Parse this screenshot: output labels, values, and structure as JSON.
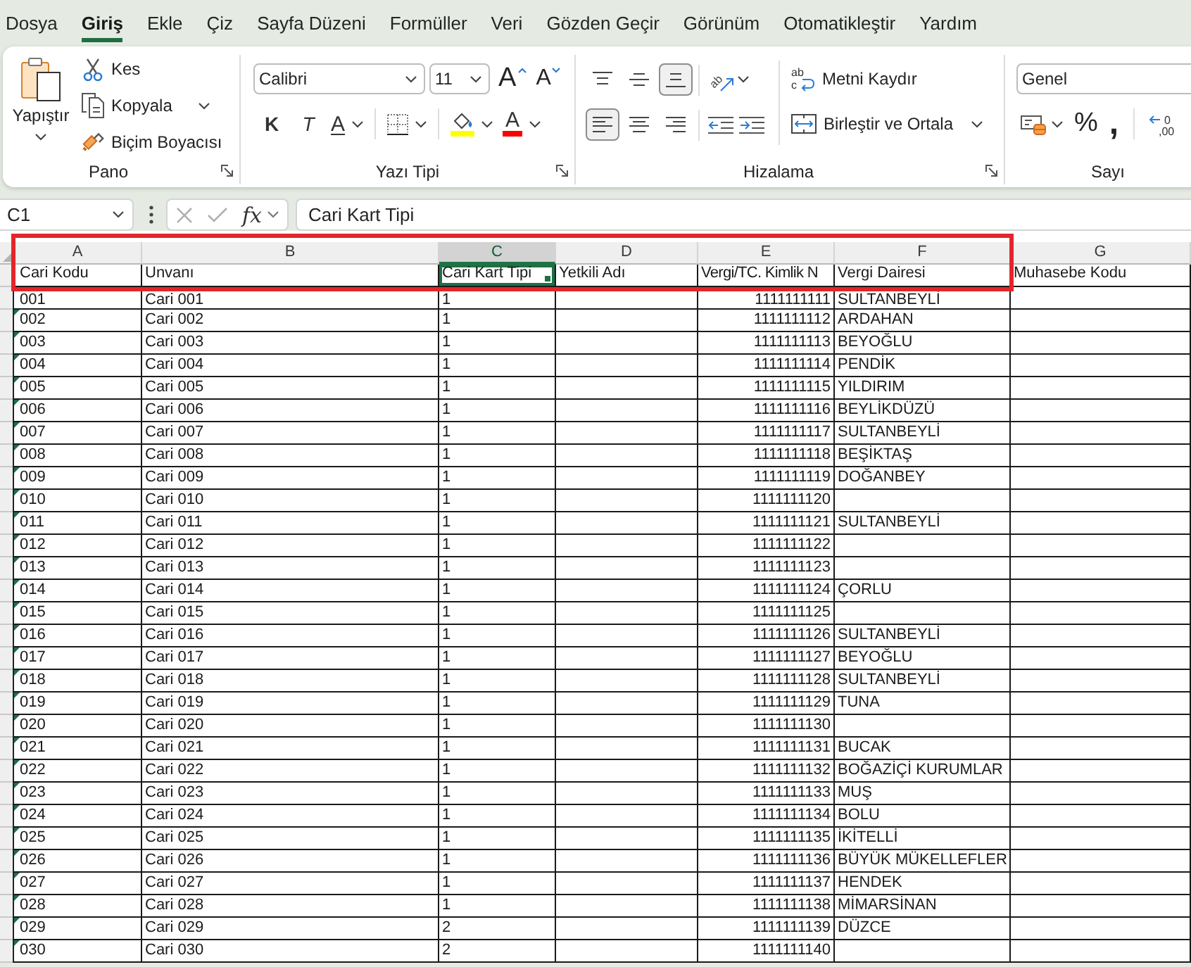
{
  "ribbon_tabs": [
    {
      "label": "Dosya",
      "selected": false
    },
    {
      "label": "Giriş",
      "selected": true
    },
    {
      "label": "Ekle",
      "selected": false
    },
    {
      "label": "Çiz",
      "selected": false
    },
    {
      "label": "Sayfa Düzeni",
      "selected": false
    },
    {
      "label": "Formüller",
      "selected": false
    },
    {
      "label": "Veri",
      "selected": false
    },
    {
      "label": "Gözden Geçir",
      "selected": false
    },
    {
      "label": "Görünüm",
      "selected": false
    },
    {
      "label": "Otomatikleştir",
      "selected": false
    },
    {
      "label": "Yardım",
      "selected": false
    }
  ],
  "clipboard_group": {
    "label": "Pano",
    "paste": "Yapıştır",
    "cut": "Kes",
    "copy": "Kopyala",
    "format_painter": "Biçim Boyacısı"
  },
  "font_group": {
    "label": "Yazı Tipi",
    "font_name": "Calibri",
    "font_size": "11",
    "grow_font": "A",
    "shrink_font": "A",
    "bold": "K",
    "italic": "T",
    "underline": "A",
    "font_color": "A"
  },
  "alignment_group": {
    "label": "Hizalama",
    "vertical": [
      {
        "kind": "top",
        "selected": false
      },
      {
        "kind": "middle",
        "selected": false
      },
      {
        "kind": "bottom",
        "selected": true
      }
    ],
    "horizontal": [
      {
        "kind": "left",
        "selected": true
      },
      {
        "kind": "center",
        "selected": false
      },
      {
        "kind": "right",
        "selected": false
      }
    ],
    "orientation_glyph": "ab",
    "wrap_glyph": "ab",
    "wrap_glyph_2": "c",
    "wrap_text": "Metni Kaydır",
    "merge_center": "Birleştir ve Ortala"
  },
  "number_group": {
    "label": "Sayı",
    "format": "Genel",
    "percent": "%",
    "comma": ",",
    "decimal_glyph": "0",
    "decimal_glyph_2": ",00"
  },
  "formula_bar": {
    "name_box": "C1",
    "fx": "fx",
    "formula": "Cari Kart Tipi"
  },
  "sheet": {
    "columns": [
      {
        "letter": "A",
        "selected": false
      },
      {
        "letter": "B",
        "selected": false
      },
      {
        "letter": "C",
        "selected": true
      },
      {
        "letter": "D",
        "selected": false
      },
      {
        "letter": "E",
        "selected": false
      },
      {
        "letter": "F",
        "selected": false
      },
      {
        "letter": "G",
        "selected": false
      }
    ],
    "header_row": {
      "cari_kodu": "Cari Kodu",
      "unvani": "Unvanı",
      "cari_kart_tipi": "Cari Kart Tipi",
      "yetkili_adi": "Yetkili Adı",
      "vergi_kimlik_no": "Vergi/TC. Kimlik N",
      "vergi_dairesi": "Vergi Dairesi",
      "muhasebe_kodu": "Muhasebe Kodu"
    },
    "rows": [
      {
        "cari_kodu": "001",
        "unvani": "Cari 001",
        "cari_kart_tipi": "1",
        "vergi_kimlik_no": "1111111111",
        "vergi_dairesi": "SULTANBEYLİ"
      },
      {
        "cari_kodu": "002",
        "unvani": "Cari 002",
        "cari_kart_tipi": "1",
        "vergi_kimlik_no": "1111111112",
        "vergi_dairesi": "ARDAHAN",
        "flagged": true
      },
      {
        "cari_kodu": "003",
        "unvani": "Cari 003",
        "cari_kart_tipi": "1",
        "vergi_kimlik_no": "1111111113",
        "vergi_dairesi": "BEYOĞLU",
        "flagged": true
      },
      {
        "cari_kodu": "004",
        "unvani": "Cari 004",
        "cari_kart_tipi": "1",
        "vergi_kimlik_no": "1111111114",
        "vergi_dairesi": "PENDİK",
        "flagged": true
      },
      {
        "cari_kodu": "005",
        "unvani": "Cari 005",
        "cari_kart_tipi": "1",
        "vergi_kimlik_no": "1111111115",
        "vergi_dairesi": "YILDIRIM",
        "flagged": true
      },
      {
        "cari_kodu": "006",
        "unvani": "Cari 006",
        "cari_kart_tipi": "1",
        "vergi_kimlik_no": "1111111116",
        "vergi_dairesi": "BEYLİKDÜZÜ",
        "flagged": true
      },
      {
        "cari_kodu": "007",
        "unvani": "Cari 007",
        "cari_kart_tipi": "1",
        "vergi_kimlik_no": "1111111117",
        "vergi_dairesi": "SULTANBEYLİ",
        "flagged": true
      },
      {
        "cari_kodu": "008",
        "unvani": "Cari 008",
        "cari_kart_tipi": "1",
        "vergi_kimlik_no": "1111111118",
        "vergi_dairesi": "BEŞİKTAŞ",
        "flagged": true
      },
      {
        "cari_kodu": "009",
        "unvani": "Cari 009",
        "cari_kart_tipi": "1",
        "vergi_kimlik_no": "1111111119",
        "vergi_dairesi": "DOĞANBEY",
        "flagged": true
      },
      {
        "cari_kodu": "010",
        "unvani": "Cari 010",
        "cari_kart_tipi": "1",
        "vergi_kimlik_no": "1111111120",
        "flagged": true
      },
      {
        "cari_kodu": "011",
        "unvani": "Cari 011",
        "cari_kart_tipi": "1",
        "vergi_kimlik_no": "1111111121",
        "vergi_dairesi": "SULTANBEYLİ",
        "flagged": true
      },
      {
        "cari_kodu": "012",
        "unvani": "Cari 012",
        "cari_kart_tipi": "1",
        "vergi_kimlik_no": "1111111122",
        "flagged": true
      },
      {
        "cari_kodu": "013",
        "unvani": "Cari 013",
        "cari_kart_tipi": "1",
        "vergi_kimlik_no": "1111111123",
        "flagged": true
      },
      {
        "cari_kodu": "014",
        "unvani": "Cari 014",
        "cari_kart_tipi": "1",
        "vergi_kimlik_no": "1111111124",
        "vergi_dairesi": "ÇORLU",
        "flagged": true
      },
      {
        "cari_kodu": "015",
        "unvani": "Cari 015",
        "cari_kart_tipi": "1",
        "vergi_kimlik_no": "1111111125",
        "flagged": true
      },
      {
        "cari_kodu": "016",
        "unvani": "Cari 016",
        "cari_kart_tipi": "1",
        "vergi_kimlik_no": "1111111126",
        "vergi_dairesi": "SULTANBEYLİ",
        "flagged": true
      },
      {
        "cari_kodu": "017",
        "unvani": "Cari 017",
        "cari_kart_tipi": "1",
        "vergi_kimlik_no": "1111111127",
        "vergi_dairesi": "BEYOĞLU",
        "flagged": true
      },
      {
        "cari_kodu": "018",
        "unvani": "Cari 018",
        "cari_kart_tipi": "1",
        "vergi_kimlik_no": "1111111128",
        "vergi_dairesi": "SULTANBEYLİ",
        "flagged": true
      },
      {
        "cari_kodu": "019",
        "unvani": "Cari 019",
        "cari_kart_tipi": "1",
        "vergi_kimlik_no": "1111111129",
        "vergi_dairesi": "TUNA",
        "flagged": true
      },
      {
        "cari_kodu": "020",
        "unvani": "Cari 020",
        "cari_kart_tipi": "1",
        "vergi_kimlik_no": "1111111130",
        "flagged": true
      },
      {
        "cari_kodu": "021",
        "unvani": "Cari 021",
        "cari_kart_tipi": "1",
        "vergi_kimlik_no": "1111111131",
        "vergi_dairesi": "BUCAK",
        "flagged": true
      },
      {
        "cari_kodu": "022",
        "unvani": "Cari 022",
        "cari_kart_tipi": "1",
        "vergi_kimlik_no": "1111111132",
        "vergi_dairesi": "BOĞAZİÇİ KURUMLAR",
        "flagged": true
      },
      {
        "cari_kodu": "023",
        "unvani": "Cari 023",
        "cari_kart_tipi": "1",
        "vergi_kimlik_no": "1111111133",
        "vergi_dairesi": "MUŞ",
        "flagged": true
      },
      {
        "cari_kodu": "024",
        "unvani": "Cari 024",
        "cari_kart_tipi": "1",
        "vergi_kimlik_no": "1111111134",
        "vergi_dairesi": "BOLU",
        "flagged": true
      },
      {
        "cari_kodu": "025",
        "unvani": "Cari 025",
        "cari_kart_tipi": "1",
        "vergi_kimlik_no": "1111111135",
        "vergi_dairesi": "İKİTELLİ",
        "flagged": true
      },
      {
        "cari_kodu": "026",
        "unvani": "Cari 026",
        "cari_kart_tipi": "1",
        "vergi_kimlik_no": "1111111136",
        "vergi_dairesi": "BÜYÜK MÜKELLEFLER",
        "flagged": true
      },
      {
        "cari_kodu": "027",
        "unvani": "Cari 027",
        "cari_kart_tipi": "1",
        "vergi_kimlik_no": "1111111137",
        "vergi_dairesi": "HENDEK",
        "flagged": true
      },
      {
        "cari_kodu": "028",
        "unvani": "Cari 028",
        "cari_kart_tipi": "1",
        "vergi_kimlik_no": "1111111138",
        "vergi_dairesi": "MİMARSİNAN",
        "flagged": true
      },
      {
        "cari_kodu": "029",
        "unvani": "Cari 029",
        "cari_kart_tipi": "2",
        "vergi_kimlik_no": "1111111139",
        "vergi_dairesi": "DÜZCE",
        "flagged": true
      },
      {
        "cari_kodu": "030",
        "unvani": "Cari 030",
        "cari_kart_tipi": "2",
        "vergi_kimlik_no": "1111111140",
        "flagged": true
      }
    ]
  }
}
